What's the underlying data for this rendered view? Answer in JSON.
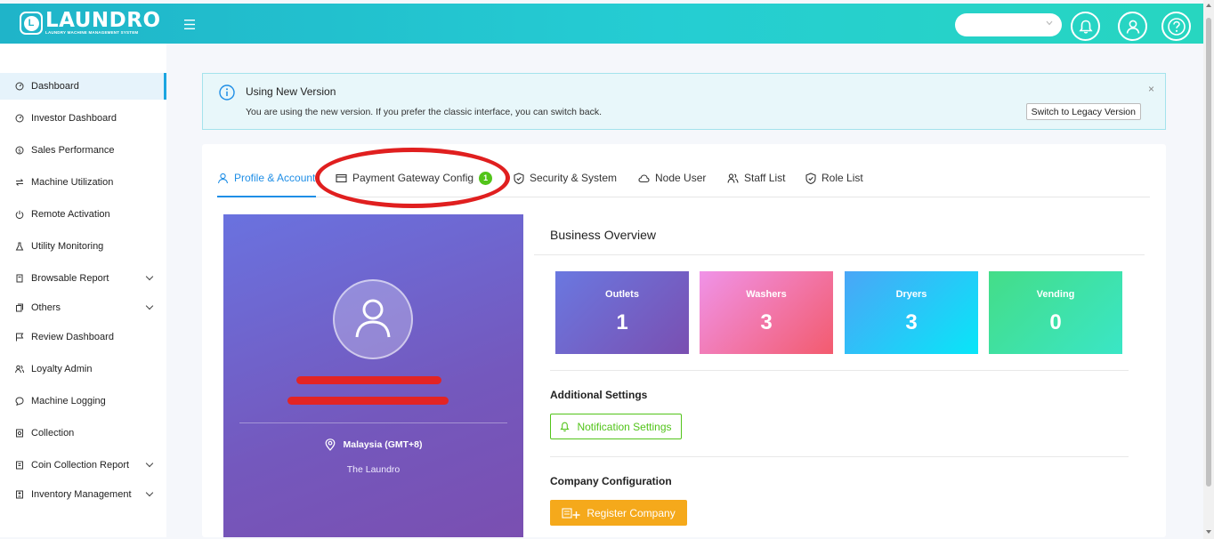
{
  "header": {
    "logo_mark": "L",
    "logo_title": "LAUNDRO",
    "logo_subtitle": "LAUNDRY MACHINE MANAGEMENT SYSTEM",
    "menu_icon": "hamburger-icon",
    "outlet_select_value": "",
    "icons": [
      "bell-icon",
      "user-icon",
      "help-icon"
    ]
  },
  "sidebar": {
    "items": [
      {
        "label": "Dashboard",
        "icon": "dashboard-icon",
        "active": true
      },
      {
        "label": "Investor Dashboard",
        "icon": "dashboard-icon"
      },
      {
        "label": "Sales Performance",
        "icon": "dollar-icon"
      },
      {
        "label": "Machine Utilization",
        "icon": "swap-icon"
      },
      {
        "label": "Remote Activation",
        "icon": "power-icon"
      },
      {
        "label": "Utility Monitoring",
        "icon": "flask-icon"
      },
      {
        "label": "Browsable Report",
        "icon": "report-icon",
        "expandable": true
      },
      {
        "label": "Others",
        "icon": "copy-icon",
        "expandable": true
      },
      {
        "label": "Review Dashboard",
        "icon": "flag-icon"
      },
      {
        "label": "Loyalty Admin",
        "icon": "users-icon"
      },
      {
        "label": "Machine Logging",
        "icon": "message-icon"
      },
      {
        "label": "Collection",
        "icon": "box-icon"
      },
      {
        "label": "Coin Collection Report",
        "icon": "money-icon",
        "expandable": true
      },
      {
        "label": "Inventory Management",
        "icon": "calculator-icon",
        "expandable": true
      }
    ]
  },
  "banner": {
    "title": "Using New Version",
    "message": "You are using the new version. If you prefer the classic interface, you can switch back.",
    "close": "×",
    "button_label": "Switch to Legacy Version"
  },
  "tabs": [
    {
      "label": "Profile & Account",
      "icon": "user-icon",
      "active": true
    },
    {
      "label": "Payment Gateway Config",
      "icon": "credit-card-icon",
      "badge": "1"
    },
    {
      "label": "Security & System",
      "icon": "shield-check-icon"
    },
    {
      "label": "Node User",
      "icon": "cloud-icon"
    },
    {
      "label": "Staff List",
      "icon": "team-icon"
    },
    {
      "label": "Role List",
      "icon": "shield-check-icon"
    }
  ],
  "profile": {
    "location": "Malaysia (GMT+8)",
    "company": "The Laundro"
  },
  "overview": {
    "title": "Business Overview",
    "stats": [
      {
        "label": "Outlets",
        "value": "1",
        "gradient": [
          "#6a78e0",
          "#7a4fb1"
        ]
      },
      {
        "label": "Washers",
        "value": "3",
        "gradient": [
          "#f093e8",
          "#f35b6e"
        ]
      },
      {
        "label": "Dryers",
        "value": "3",
        "gradient": [
          "#4aa6f7",
          "#08e6f8"
        ]
      },
      {
        "label": "Vending",
        "value": "0",
        "gradient": [
          "#44dd88",
          "#3ae6c6"
        ]
      }
    ],
    "additional_title": "Additional Settings",
    "notification_button": "Notification Settings",
    "company_title": "Company Configuration",
    "register_button": "Register Company"
  },
  "colors": {
    "accent": "#1f8ee6",
    "success": "#52c41a",
    "warning": "#f5a91b",
    "annotation": "#e01f1f"
  }
}
